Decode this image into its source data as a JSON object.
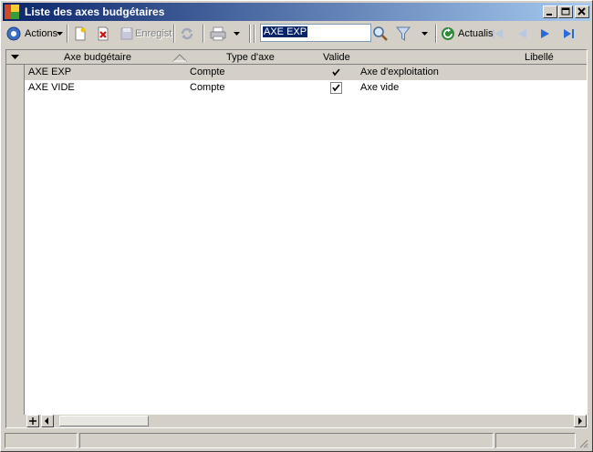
{
  "window": {
    "title": "Liste des axes budgétaires",
    "colors": {
      "titlebar_start": "#0a246a",
      "titlebar_end": "#a6caf0",
      "face": "#d4d0c8",
      "selection": "#0a246a"
    }
  },
  "toolbar": {
    "actions_label": "Actions",
    "save_label": "Enregist",
    "refresh_label": "Actualis",
    "search_value": "AXE EXP"
  },
  "grid": {
    "columns": [
      "Axe budgétaire",
      "Type d'axe",
      "Valide",
      "Libellé"
    ],
    "sorted_column": "Axe budgétaire",
    "rows": [
      {
        "axe": "AXE EXP",
        "type": "Compte",
        "valide": true,
        "libelle": "Axe d'exploitation",
        "selected": true
      },
      {
        "axe": "AXE VIDE",
        "type": "Compte",
        "valide": true,
        "libelle": "Axe vide",
        "selected": false
      }
    ]
  },
  "icons": {
    "actions": "actions-circle-icon",
    "new": "new-document-icon",
    "delete": "delete-icon",
    "save": "save-icon",
    "sync": "sync-icon",
    "print": "print-icon",
    "search": "magnifier-icon",
    "filter": "filter-funnel-icon",
    "refresh": "refresh-icon",
    "first": "first-record-icon",
    "prev": "previous-record-icon",
    "next": "next-record-icon",
    "last": "last-record-icon"
  }
}
